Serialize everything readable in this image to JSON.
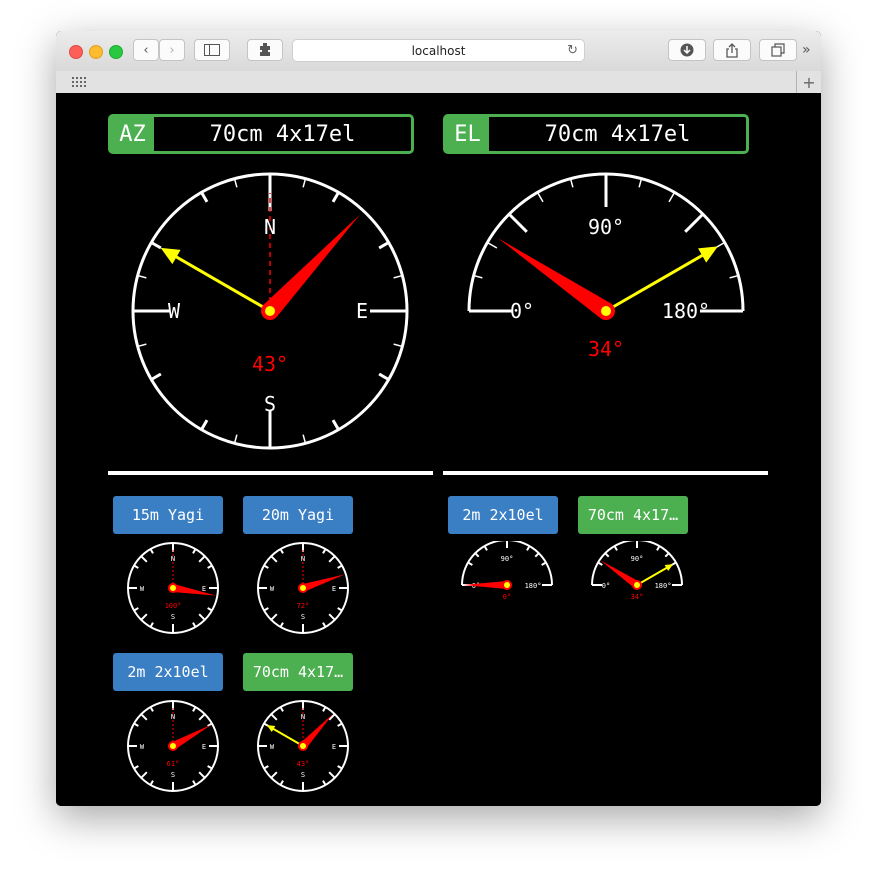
{
  "browser": {
    "url": "localhost"
  },
  "colors": {
    "green": "#4caf50",
    "blue": "#3a7fc4",
    "pointer": "#ff0000",
    "target": "#ffff00"
  },
  "az_panel": {
    "tag": "AZ",
    "antenna": "70cm 4x17el",
    "heading_deg": 43,
    "target_deg": 300,
    "reading": "43°",
    "labels": {
      "n": "N",
      "e": "E",
      "s": "S",
      "w": "W"
    }
  },
  "el_panel": {
    "tag": "EL",
    "antenna": "70cm 4x17el",
    "reading": "34°",
    "pointer_deg": 34,
    "target_deg": 150,
    "labels": {
      "left": "0°",
      "top": "90°",
      "right": "180°"
    }
  },
  "az_list": [
    {
      "name": "15m Yagi",
      "color": "blue",
      "heading_deg": 100,
      "reading": "100°"
    },
    {
      "name": "20m Yagi",
      "color": "blue",
      "heading_deg": 72,
      "reading": "72°"
    },
    {
      "name": "2m 2x10el",
      "color": "blue",
      "heading_deg": 61,
      "reading": "61°"
    },
    {
      "name": "70cm 4x17…",
      "color": "green",
      "heading_deg": 43,
      "reading": "43°",
      "target_deg": 300
    }
  ],
  "el_list": [
    {
      "name": "2m 2x10el",
      "color": "blue",
      "pointer_deg": 0,
      "reading": "0°"
    },
    {
      "name": "70cm 4x17…",
      "color": "green",
      "pointer_deg": 34,
      "reading": "34°",
      "target_deg": 150
    }
  ]
}
